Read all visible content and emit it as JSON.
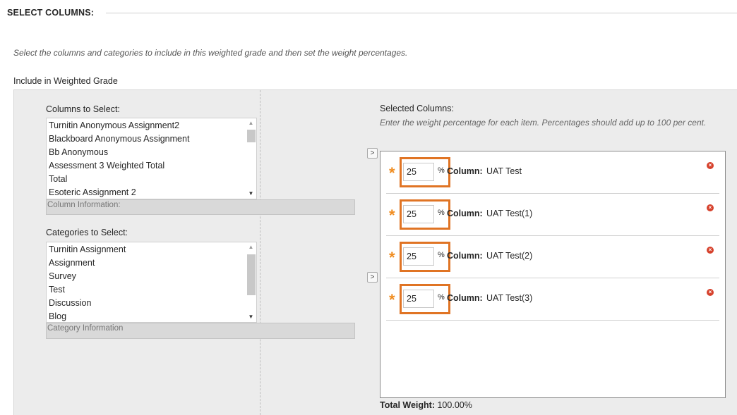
{
  "section": {
    "title": "SELECT COLUMNS:"
  },
  "instructions": "Select the columns and categories to include in this weighted grade and then set the weight percentages.",
  "include_label": "Include in Weighted Grade",
  "columns_to_select": {
    "label": "Columns to Select:",
    "items": [
      "Turnitin Anonymous Assignment2",
      "Blackboard Anonymous Assignment",
      "Bb Anonymous",
      "Assessment 3 Weighted Total",
      "Total",
      "Esoteric Assignment 2"
    ],
    "info": "Column Information:"
  },
  "categories_to_select": {
    "label": "Categories to Select:",
    "items": [
      "Turnitin Assignment",
      "Assignment",
      "Survey",
      "Test",
      "Discussion",
      "Blog"
    ],
    "info": "Category Information"
  },
  "move_button_glyph": ">",
  "selected_columns": {
    "label": "Selected Columns:",
    "help": "Enter the weight percentage for each item. Percentages should add up to 100 per cent.",
    "required_glyph": "*",
    "percent_sign": "%",
    "column_prefix": "Column:",
    "rows": [
      {
        "weight": "25",
        "name": "UAT Test"
      },
      {
        "weight": "25",
        "name": "UAT Test(1)"
      },
      {
        "weight": "25",
        "name": "UAT Test(2)"
      },
      {
        "weight": "25",
        "name": "UAT Test(3)"
      }
    ]
  },
  "total_weight": {
    "label": "Total Weight:",
    "value": "100.00%"
  },
  "colors": {
    "highlight": "#e07424",
    "required": "#f08c1f",
    "remove": "#d6412c"
  },
  "icons": {
    "remove": "remove-icon",
    "move": "arrow-right-icon",
    "scroll_up": "scroll-up-icon",
    "scroll_down": "scroll-down-icon"
  }
}
